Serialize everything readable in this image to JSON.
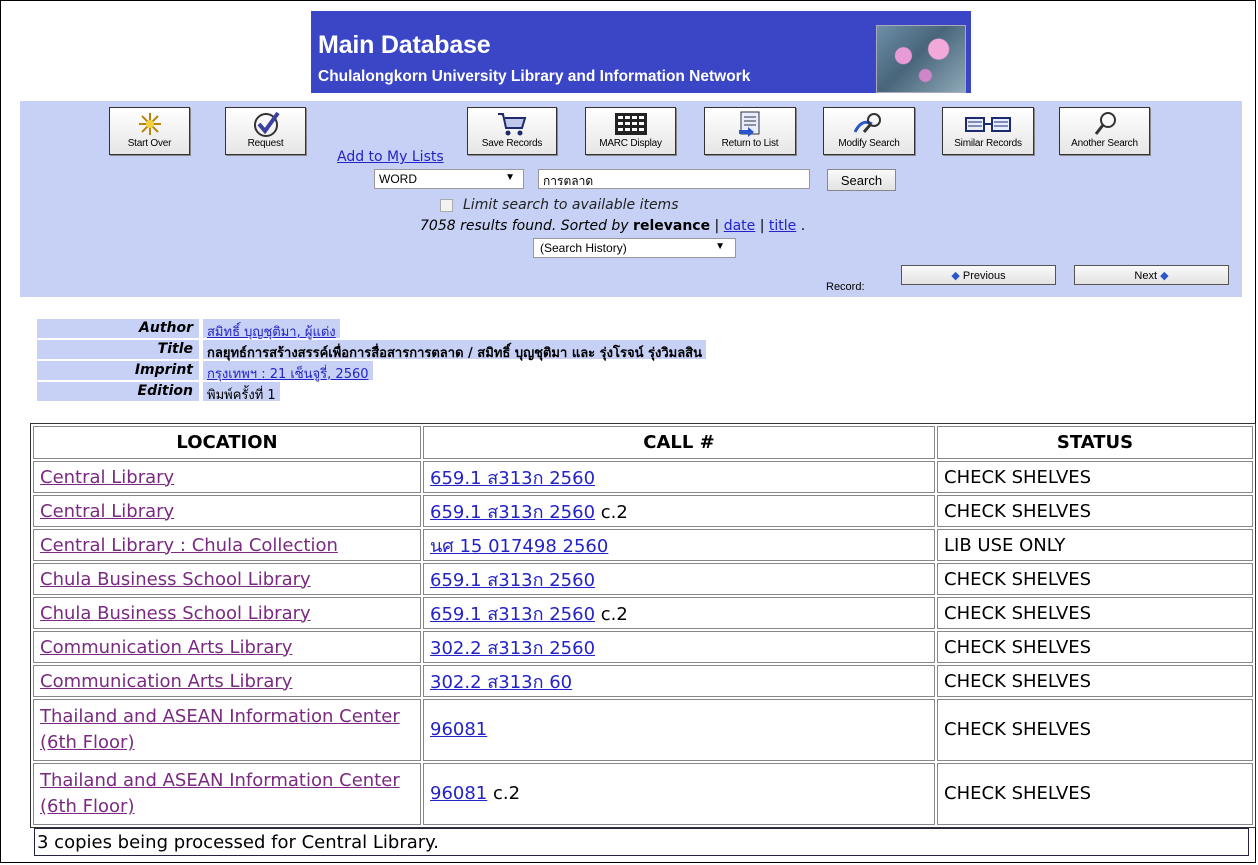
{
  "banner": {
    "title": "Main Database",
    "subtitle": "Chulalongkorn University Library and Information Network"
  },
  "toolbar": {
    "buttons": [
      {
        "label": "Start Over",
        "icon": "start-over-icon"
      },
      {
        "label": "Request",
        "icon": "checkmark-icon"
      },
      {
        "label": "Save Records",
        "icon": "cart-icon"
      },
      {
        "label": "MARC Display",
        "icon": "marc-grid-icon"
      },
      {
        "label": "Return to List",
        "icon": "list-return-icon"
      },
      {
        "label": "Modify Search",
        "icon": "modify-search-icon"
      },
      {
        "label": "Similar Records",
        "icon": "similar-records-icon"
      },
      {
        "label": "Another Search",
        "icon": "magnifier-icon"
      }
    ],
    "add_to_lists": "Add to My Lists"
  },
  "search": {
    "index_value": "WORD",
    "query_value": "การตลาด",
    "button_label": "Search",
    "limit_label": "Limit search to available items",
    "results_prefix": "7058 results found. Sorted by",
    "sort_current": "relevance",
    "sort_date": "date",
    "sort_title": "title",
    "history_value": "(Search History)"
  },
  "record_nav": {
    "label": "Record:",
    "previous": "Previous",
    "next": "Next"
  },
  "bib": {
    "author_label": "Author",
    "author_value": "สมิทธิ์ บุญชุติมา, ผู้แต่ง",
    "title_label": "Title",
    "title_value": "กลยุทธ์การสร้างสรรค์เพื่อการสื่อสารการตลาด / สมิทธิ์ บุญชุติมา และ รุ่งโรจน์ รุ่งวิมลสิน",
    "imprint_label": "Imprint",
    "imprint_value": "กรุงเทพฯ : 21 เซ็นจูรี่, 2560",
    "edition_label": "Edition",
    "edition_value": "พิมพ์ครั้งที่ 1"
  },
  "holdings": {
    "headers": {
      "location": "LOCATION",
      "call": "CALL #",
      "status": "STATUS"
    },
    "rows": [
      {
        "location": "Central Library",
        "call": "659.1 ส313ก 2560",
        "copy": "",
        "status": "CHECK SHELVES"
      },
      {
        "location": "Central Library",
        "call": "659.1 ส313ก 2560",
        "copy": "c.2",
        "status": "CHECK SHELVES"
      },
      {
        "location": "Central Library : Chula Collection",
        "call": "นศ 15 017498 2560",
        "copy": "",
        "status": "LIB USE ONLY"
      },
      {
        "location": "Chula Business School Library",
        "call": "659.1 ส313ก 2560",
        "copy": "",
        "status": "CHECK SHELVES"
      },
      {
        "location": "Chula Business School Library",
        "call": "659.1 ส313ก 2560",
        "copy": "c.2",
        "status": "CHECK SHELVES"
      },
      {
        "location": "Communication Arts Library",
        "call": "302.2 ส313ก 2560",
        "copy": "",
        "status": "CHECK SHELVES"
      },
      {
        "location": "Communication Arts Library",
        "call": "302.2 ส313ก 60",
        "copy": "",
        "status": "CHECK SHELVES"
      },
      {
        "location": "Thailand and ASEAN Information Center (6th Floor)",
        "call": "96081",
        "copy": "",
        "status": "CHECK SHELVES"
      },
      {
        "location": "Thailand and ASEAN Information Center (6th Floor)",
        "call": "96081",
        "copy": "c.2",
        "status": "CHECK SHELVES"
      }
    ],
    "note": "3 copies being processed for Central Library."
  },
  "colors": {
    "banner_blue": "#3a46c6",
    "panel_blue": "#c7d1f5",
    "link_blue": "#2323c8",
    "link_visited": "#7a2a80"
  }
}
